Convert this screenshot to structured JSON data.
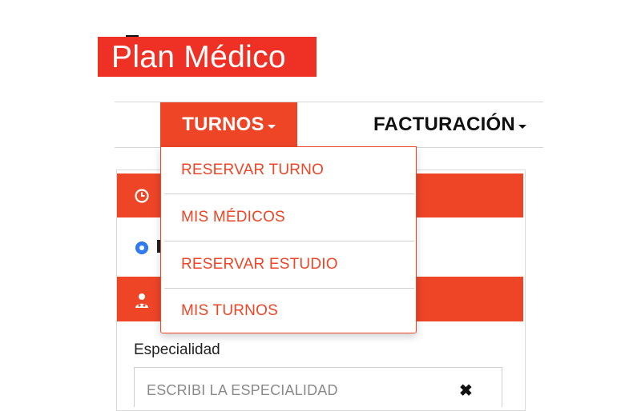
{
  "brand": {
    "logo_mark": "+HA",
    "logo_text": "Plan Médico",
    "colors": {
      "red": "#ee3124",
      "yellow": "#f5c400",
      "black": "#111111"
    }
  },
  "nav": {
    "items": [
      {
        "label": "TURNOS",
        "active": true
      },
      {
        "label": "FACTURACIÓN",
        "active": false
      }
    ]
  },
  "dropdown": {
    "items": [
      {
        "label": "RESERVAR TURNO"
      },
      {
        "label": "MIS MÉDICOS"
      },
      {
        "label": "RESERVAR ESTUDIO"
      },
      {
        "label": "MIS TURNOS"
      }
    ]
  },
  "form": {
    "specialty_label": "Especialidad",
    "specialty_placeholder": "ESCRIBI LA ESPECIALIDAD",
    "clear_symbol": "✖"
  },
  "icons": {
    "section1": "clock-icon",
    "section2": "doctor-icon",
    "caret": "caret-down-icon"
  }
}
